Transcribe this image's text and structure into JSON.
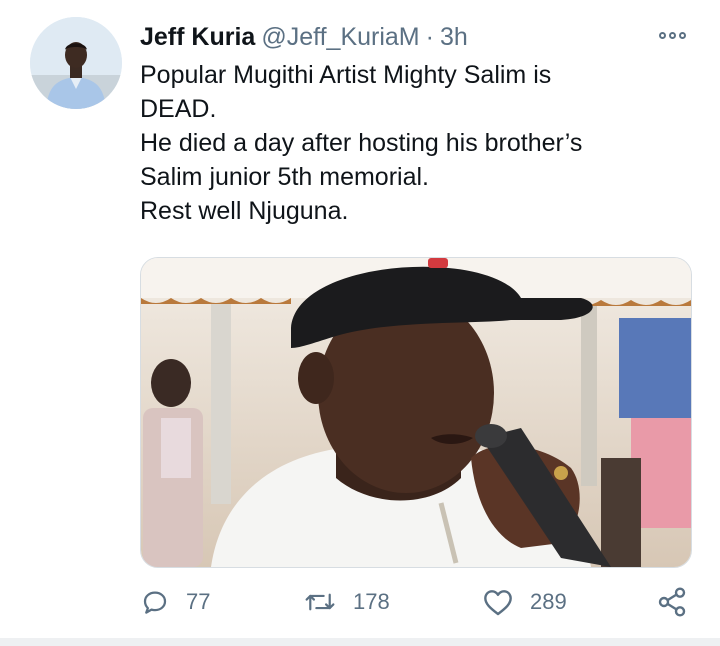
{
  "author": {
    "name": "Jeff Kuria",
    "handle": "@Jeff_KuriaM",
    "separator": "·",
    "time": "3h"
  },
  "tweet": {
    "lines": [
      "Popular Mugithi Artist Mighty Salim is",
      "DEAD.",
      "He died a day after hosting his brother’s",
      "Salim junior 5th memorial.",
      "Rest well Njuguna."
    ]
  },
  "actions": {
    "replies": "77",
    "retweets": "178",
    "likes": "289"
  },
  "icons": {
    "more": "more-options-icon",
    "reply": "reply-icon",
    "retweet": "retweet-icon",
    "like": "heart-icon",
    "share": "share-icon"
  },
  "colors": {
    "text": "#0f1419",
    "secondary": "#5b7083"
  }
}
